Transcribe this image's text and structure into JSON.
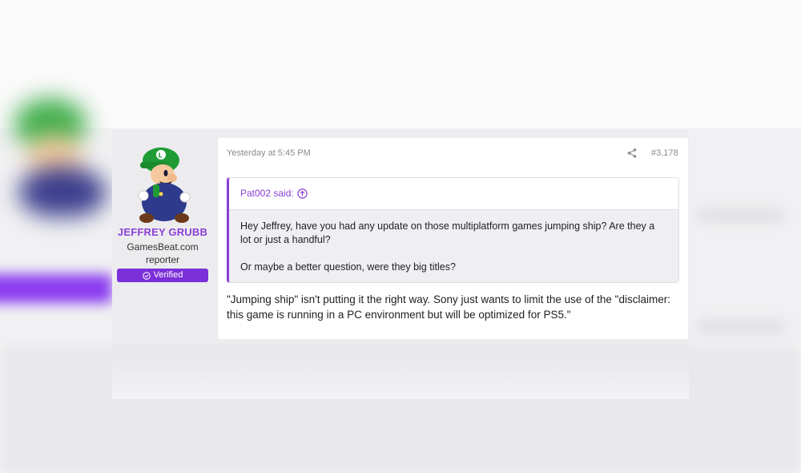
{
  "user": {
    "name": "JEFFREY GRUBB",
    "title_line1": "GamesBeat.com",
    "title_line2": "reporter",
    "badge": "Verified"
  },
  "post": {
    "timestamp": "Yesterday at 5:45 PM",
    "number": "#3,178",
    "quote": {
      "author_label": "Pat002 said:",
      "paragraphs": [
        "Hey Jeffrey, have you had any update on those multiplatform games jumping ship? Are they a lot or just a handful?",
        "Or maybe a better question, were they big titles?"
      ]
    },
    "body": "\"Jumping ship\" isn't putting it the right way. Sony just wants to limit the use of the \"disclaimer: this game is running in a PC environment but will be optimized for PS5.\""
  },
  "icons": {
    "share": "share-icon",
    "quote_jump": "arrow-up-circle-icon",
    "verified": "check-circle-icon"
  },
  "colors": {
    "accent_purple": "#8b3fd6",
    "badge_purple": "#7b2fd8"
  }
}
